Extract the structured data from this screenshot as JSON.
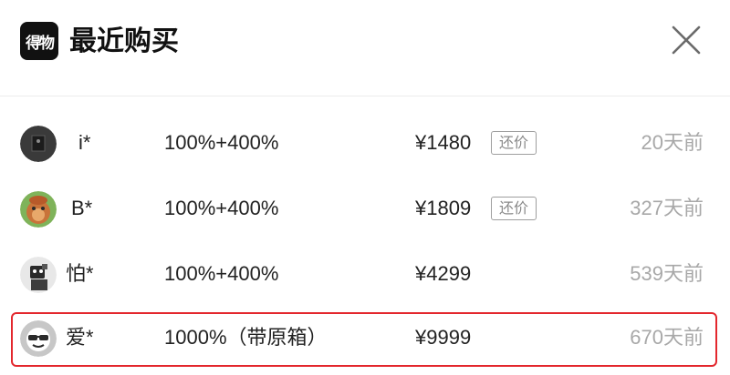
{
  "header": {
    "logo_text": "得物",
    "title": "最近购买",
    "close_icon": "close-icon"
  },
  "rows": [
    {
      "user": "i*",
      "spec": "100%+400%",
      "price": "¥1480",
      "counter_label": "还价",
      "time": "20天前",
      "avatar": "dark-square-avatar"
    },
    {
      "user": "B*",
      "spec": "100%+400%",
      "price": "¥1809",
      "counter_label": "还价",
      "time": "327天前",
      "avatar": "cartoon-avatar"
    },
    {
      "user": "怕*",
      "spec": "100%+400%",
      "price": "¥4299",
      "counter_label": "",
      "time": "539天前",
      "avatar": "photo-avatar"
    },
    {
      "user": "爱*",
      "spec": "1000%（带原箱）",
      "price": "¥9999",
      "counter_label": "",
      "time": "670天前",
      "avatar": "sunglasses-avatar"
    }
  ],
  "colors": {
    "highlight_border": "#e3272d",
    "muted_text": "#a8a8a8",
    "logo_bg": "#111111"
  }
}
